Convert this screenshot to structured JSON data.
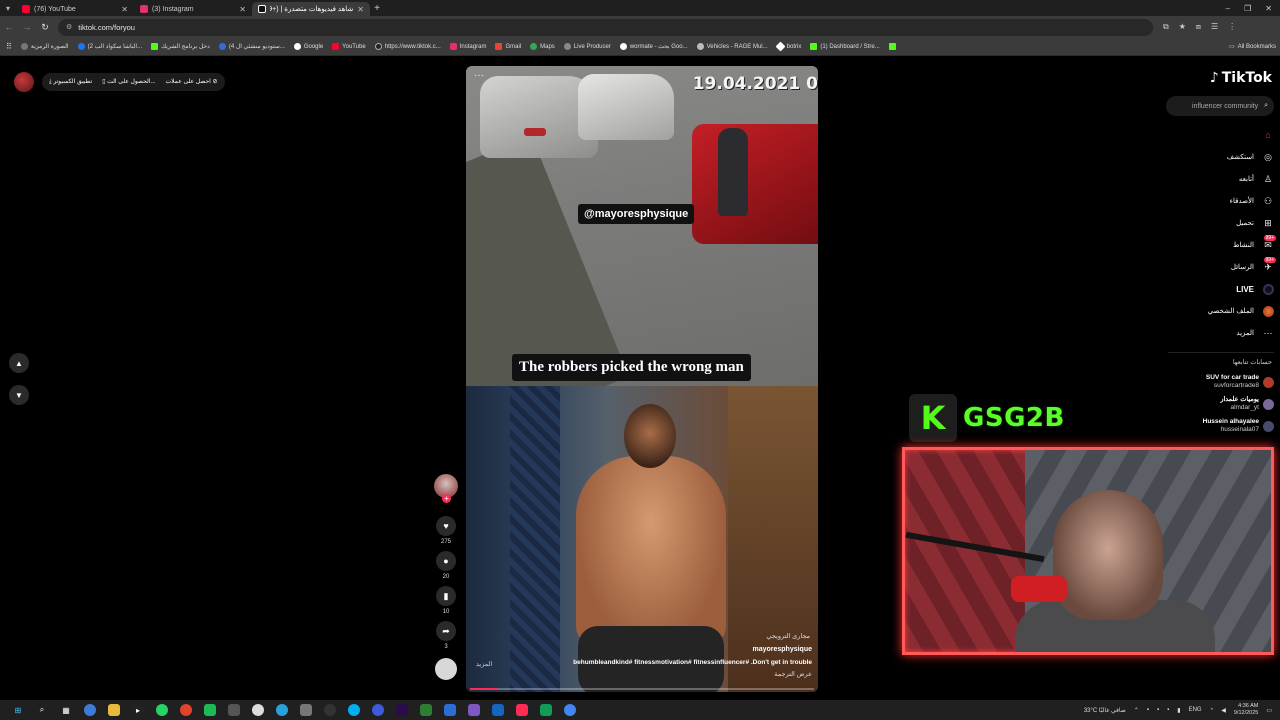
{
  "browser": {
    "tabs": [
      {
        "title": "(76) YouTube",
        "color": "#ff0033"
      },
      {
        "title": "(3) Instagram",
        "color": "#e1306c"
      },
      {
        "title": "شاهد فيديوهات متصدرة | TikTok (99+)",
        "color": "#ffffff"
      }
    ],
    "url": "tiktok.com/foryou",
    "bookmarks": [
      {
        "label": "الصورة الرمزية",
        "color": "#777"
      },
      {
        "label": "(2 الباشا سكواد الب...",
        "color": "#1877f2"
      },
      {
        "label": "دخل برنامج الشريك",
        "color": "#53fc18"
      },
      {
        "label": "(4 ستوديو منشئي ال...",
        "color": "#2f6fd6"
      },
      {
        "label": "Google",
        "color": "#fff"
      },
      {
        "label": "YouTube",
        "color": "#ff0033"
      },
      {
        "label": "https://www.tiktok.c...",
        "color": "#222"
      },
      {
        "label": "Instagram",
        "color": "#e1306c"
      },
      {
        "label": "Gmail",
        "color": "#ea4335"
      },
      {
        "label": "Maps",
        "color": "#34a853"
      },
      {
        "label": "Live Producer",
        "color": "#888"
      },
      {
        "label": "wormate - بحث Goo...",
        "color": "#fff"
      },
      {
        "label": "Vehicles - RAGE Mul...",
        "color": "#bbb"
      },
      {
        "label": "botrix",
        "color": "#fff"
      },
      {
        "label": "(1) Dashboard / Stre...",
        "color": "#53fc18"
      }
    ],
    "all_bookmarks": "All Bookmarks"
  },
  "tiktok": {
    "top_left": {
      "get_coins": "احصل على عملات",
      "get_app": "الحصول على الت...",
      "desktop_app": "تطبيق الكمبيوتر"
    },
    "logo": "TikTok",
    "search_placeholder": "influencer community",
    "nav": [
      {
        "label": "",
        "icon": "home-icon",
        "badge": ""
      },
      {
        "label": "استكشف",
        "icon": "explore-icon",
        "badge": ""
      },
      {
        "label": "أتابعه",
        "icon": "following-icon",
        "badge": ""
      },
      {
        "label": "الأصدقاء",
        "icon": "friends-icon",
        "badge": ""
      },
      {
        "label": "تحميل",
        "icon": "upload-icon",
        "badge": ""
      },
      {
        "label": "النشاط",
        "icon": "activity-icon",
        "badge": "99+"
      },
      {
        "label": "الرسائل",
        "icon": "messages-icon",
        "badge": "99+"
      },
      {
        "label": "LIVE",
        "icon": "live-icon",
        "badge": ""
      },
      {
        "label": "الملف الشخصي",
        "icon": "profile-icon",
        "badge": ""
      },
      {
        "label": "المزيد",
        "icon": "more-icon",
        "badge": ""
      }
    ],
    "following_title": "حسابات تتابعها",
    "following": [
      {
        "name": "SUV for car trade",
        "handle": "suvforcartrade8",
        "color": "#b23a2a"
      },
      {
        "name": "يوميات علمدار",
        "handle": "almdar_yt",
        "color": "#7a6a9a"
      },
      {
        "name": "Hussein alhayalee",
        "handle": "husseinala07",
        "color": "#4a4a6a"
      }
    ],
    "video": {
      "date_stamp": "19.04.2021 0",
      "tag": "@mayoresphysique",
      "caption": "The robbers picked the wrong man",
      "sound": "مجارى الترويجي",
      "author": "mayoresphysique",
      "description": "behumbleandkind# fitnessmotivation# fitnessinfluencer# .Don't get in trouble",
      "more": "المزيد",
      "translate": "عرض الترجمة",
      "progress": 0.08
    },
    "actions": {
      "likes": "275",
      "comments": "20",
      "saves": "10",
      "shares": "3"
    }
  },
  "overlay": {
    "brand_letter": "K",
    "brand_name": "GSG2B"
  },
  "taskbar": {
    "weather": "33°C  صافي غالبًا",
    "lang": "ENG",
    "time": "4:36 AM",
    "date": "9/12/2025"
  }
}
